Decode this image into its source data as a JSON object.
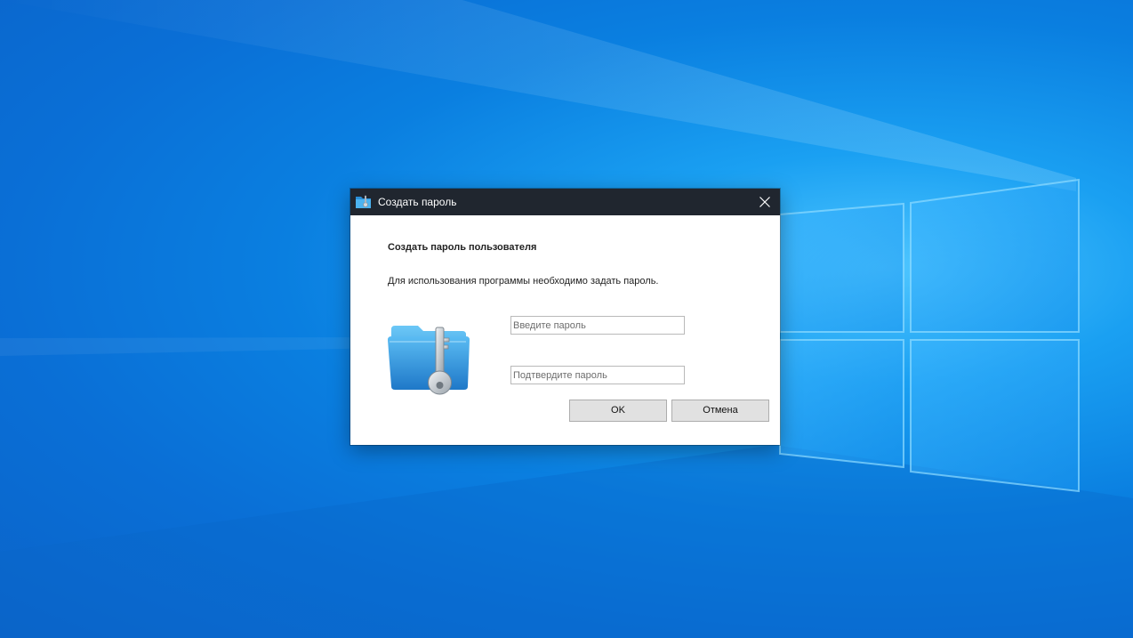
{
  "dialog": {
    "title": "Создать пароль",
    "heading": "Создать пароль пользователя",
    "description": "Для использования программы необходимо задать пароль.",
    "password_placeholder": "Введите пароль",
    "confirm_placeholder": "Подтвердите пароль",
    "ok_label": "OK",
    "cancel_label": "Отмена",
    "icons": {
      "title": "folder-key-icon",
      "close": "close-icon",
      "main": "folder-key-icon"
    }
  },
  "colors": {
    "titlebar": "#20262f",
    "desktop_accent": "#0a7fe0",
    "button_face": "#e1e1e1"
  }
}
